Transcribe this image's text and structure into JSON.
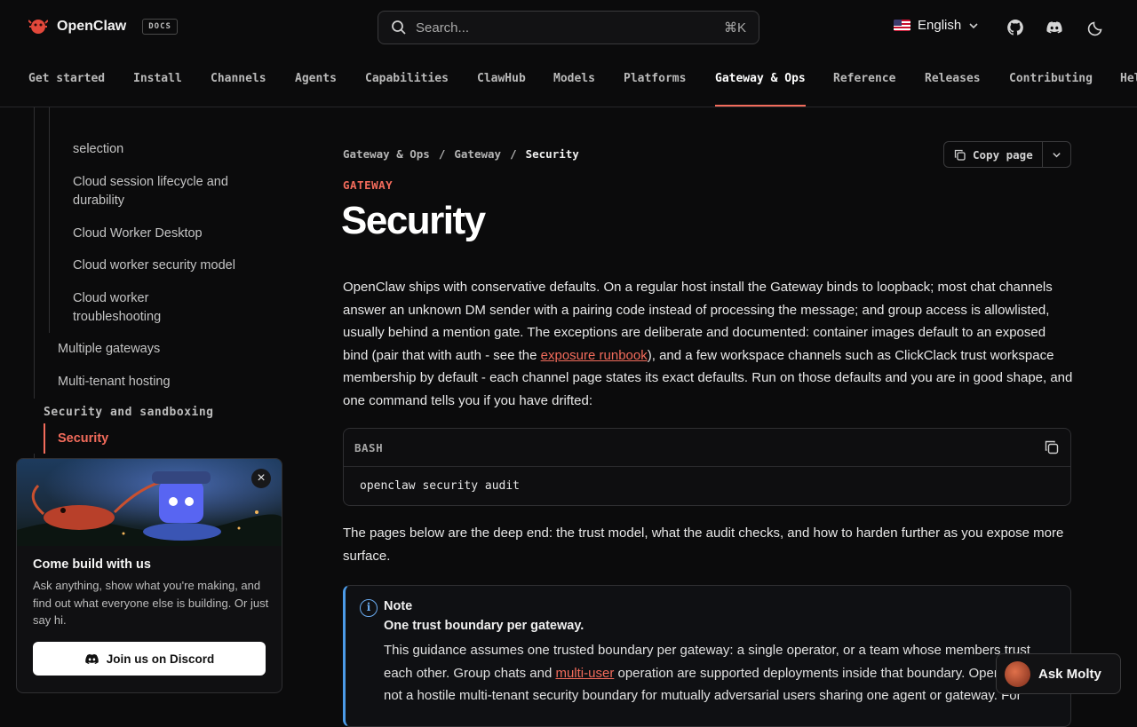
{
  "header": {
    "brand": "OpenClaw",
    "badge": "DOCS",
    "search_placeholder": "Search...",
    "search_shortcut": "⌘K",
    "language": "English",
    "icons": [
      "search-icon",
      "github-icon",
      "discord-icon",
      "theme-toggle-icon",
      "chevron-down-icon"
    ]
  },
  "tabs": [
    {
      "label": "Get started"
    },
    {
      "label": "Install"
    },
    {
      "label": "Channels"
    },
    {
      "label": "Agents"
    },
    {
      "label": "Capabilities"
    },
    {
      "label": "ClawHub"
    },
    {
      "label": "Models"
    },
    {
      "label": "Platforms"
    },
    {
      "label": "Gateway & Ops",
      "active": true
    },
    {
      "label": "Reference"
    },
    {
      "label": "Releases"
    },
    {
      "label": "Contributing"
    },
    {
      "label": "Help"
    }
  ],
  "sidebar": {
    "items": [
      {
        "label": "selection"
      },
      {
        "label": "Cloud session lifecycle and durability"
      },
      {
        "label": "Cloud Worker Desktop"
      },
      {
        "label": "Cloud worker security model"
      },
      {
        "label": "Cloud worker troubleshooting"
      },
      {
        "label": "Multiple gateways"
      },
      {
        "label": "Multi-tenant hosting"
      }
    ],
    "section": "Security and sandboxing",
    "active_item": "Security"
  },
  "discord_card": {
    "title": "Come build with us",
    "body": "Ask anything, show what you're making, and find out what everyone else is building. Or just say hi.",
    "button": "Join us on Discord",
    "close": "×"
  },
  "page": {
    "breadcrumbs": [
      "Gateway & Ops",
      "Gateway",
      "Security"
    ],
    "copy_button": "Copy page",
    "eyebrow": "GATEWAY",
    "title": "Security",
    "intro_1": "OpenClaw ships with conservative defaults. On a regular host install the Gateway binds to loopback; most chat channels answer an unknown DM sender with a pairing code instead of processing the message; and group access is allowlisted, usually behind a mention gate. The exceptions are deliberate and documented: container images default to an exposed bind (pair that with auth - see the ",
    "intro_link": "exposure runbook",
    "intro_2": "), and a few workspace channels such as ClickClack trust workspace membership by default - each channel page states its exact defaults. Run on those defaults and you are in good shape, and one command tells you if you have drifted:",
    "code_lang": "BASH",
    "code": "openclaw security audit",
    "after_code": "The pages below are the deep end: the trust model, what the audit checks, and how to harden further as you expose more surface.",
    "note": {
      "title": "Note",
      "subtitle": "One trust boundary per gateway.",
      "body_1": "This guidance assumes one trusted boundary per gateway: a single operator, or a team whose members trust each other. Group chats and ",
      "body_link": "multi-user",
      "body_2": " operation are supported deployments inside that boundary. OpenClaw is not a hostile multi-tenant security boundary for mutually adversarial users sharing one agent or gateway. For"
    }
  },
  "ask_button": "Ask Molty",
  "colors": {
    "accent": "#f26b5b",
    "note_accent": "#4c9be8",
    "background": "#0b0b0c"
  }
}
